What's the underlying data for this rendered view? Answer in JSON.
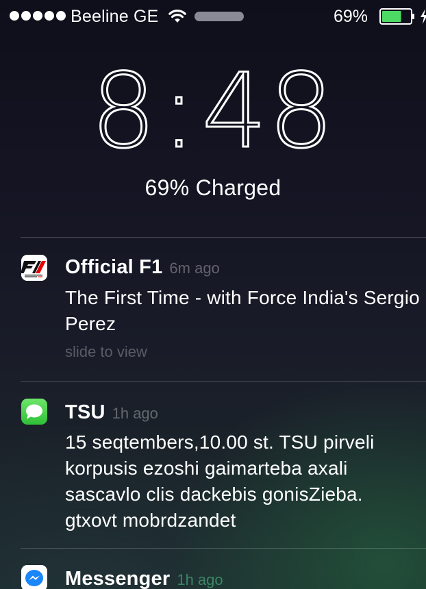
{
  "status_bar": {
    "carrier": "Beeline GE",
    "battery_percent": "69%",
    "battery_level": 0.69,
    "signal_icon": "signal-dots-icon",
    "wifi_icon": "wifi-icon",
    "battery_icon": "battery-icon",
    "charging_icon": "charging-bolt-icon",
    "colors": {
      "battery_fill": "#4cd964"
    }
  },
  "lock": {
    "time_hours": "8",
    "time_colon": ":",
    "time_minutes": "48",
    "charge_status": "69% Charged"
  },
  "notifications": [
    {
      "app": "Official F1",
      "time_ago": "6m ago",
      "message": "The First Time - with Force India's Sergio Perez",
      "hint": "slide to view",
      "icon": "f1-app-icon"
    },
    {
      "app": "TSU",
      "time_ago": "1h ago",
      "message": "15 seqtembers,10.00 st. TSU pirveli korpusis ezoshi gaimarteba axali sascavlo clis dackebis gonisZieba. gtxovt mobrdzandet",
      "icon": "messages-app-icon"
    },
    {
      "app": "Messenger",
      "time_ago": "1h ago",
      "icon": "messenger-app-icon"
    }
  ]
}
